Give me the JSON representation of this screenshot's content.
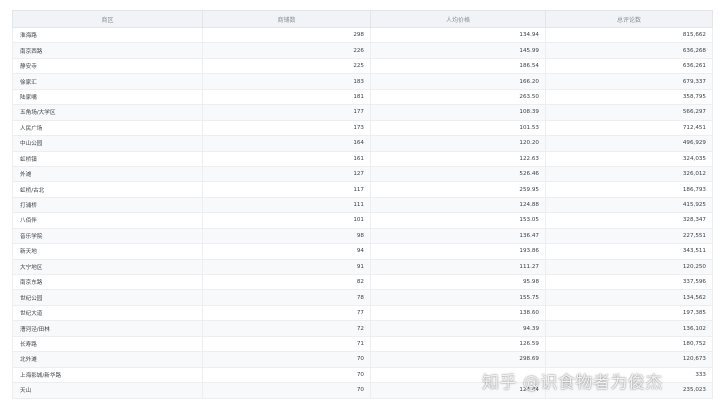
{
  "table": {
    "columns": [
      "商区",
      "商铺数",
      "人均价格",
      "总评论数"
    ],
    "rows": [
      [
        "淮海路",
        "298",
        "134.94",
        "815,662"
      ],
      [
        "南京西路",
        "226",
        "145.99",
        "636,268"
      ],
      [
        "静安寺",
        "225",
        "186.54",
        "636,261"
      ],
      [
        "徐家汇",
        "183",
        "166.20",
        "679,337"
      ],
      [
        "陆家嘴",
        "181",
        "263.50",
        "358,795"
      ],
      [
        "五角场/大学区",
        "177",
        "108.39",
        "566,297"
      ],
      [
        "人民广场",
        "173",
        "101.53",
        "712,451"
      ],
      [
        "中山公园",
        "164",
        "120.20",
        "496,929"
      ],
      [
        "虹桥镇",
        "161",
        "122.63",
        "324,035"
      ],
      [
        "外滩",
        "127",
        "526.46",
        "326,012"
      ],
      [
        "虹桥/古北",
        "117",
        "259.95",
        "186,793"
      ],
      [
        "打浦桥",
        "111",
        "124.88",
        "415,925"
      ],
      [
        "八佰伴",
        "101",
        "153.05",
        "328,347"
      ],
      [
        "音乐学院",
        "98",
        "136.47",
        "227,551"
      ],
      [
        "新天地",
        "94",
        "193.86",
        "343,511"
      ],
      [
        "大宁地区",
        "91",
        "111.27",
        "120,250"
      ],
      [
        "南京东路",
        "82",
        "95.98",
        "337,596"
      ],
      [
        "世纪公园",
        "78",
        "155.75",
        "134,562"
      ],
      [
        "世纪大道",
        "77",
        "138.60",
        "197,385"
      ],
      [
        "漕河泾/田林",
        "72",
        "94.39",
        "136,102"
      ],
      [
        "长寿路",
        "71",
        "126.59",
        "180,752"
      ],
      [
        "北外滩",
        "70",
        "298.69",
        "120,673"
      ],
      [
        "上海影城/新华路",
        "70",
        "",
        "333"
      ],
      [
        "天山",
        "70",
        "124.44",
        "235,023"
      ]
    ]
  },
  "watermark": "知乎 @识食物者为俊杰"
}
